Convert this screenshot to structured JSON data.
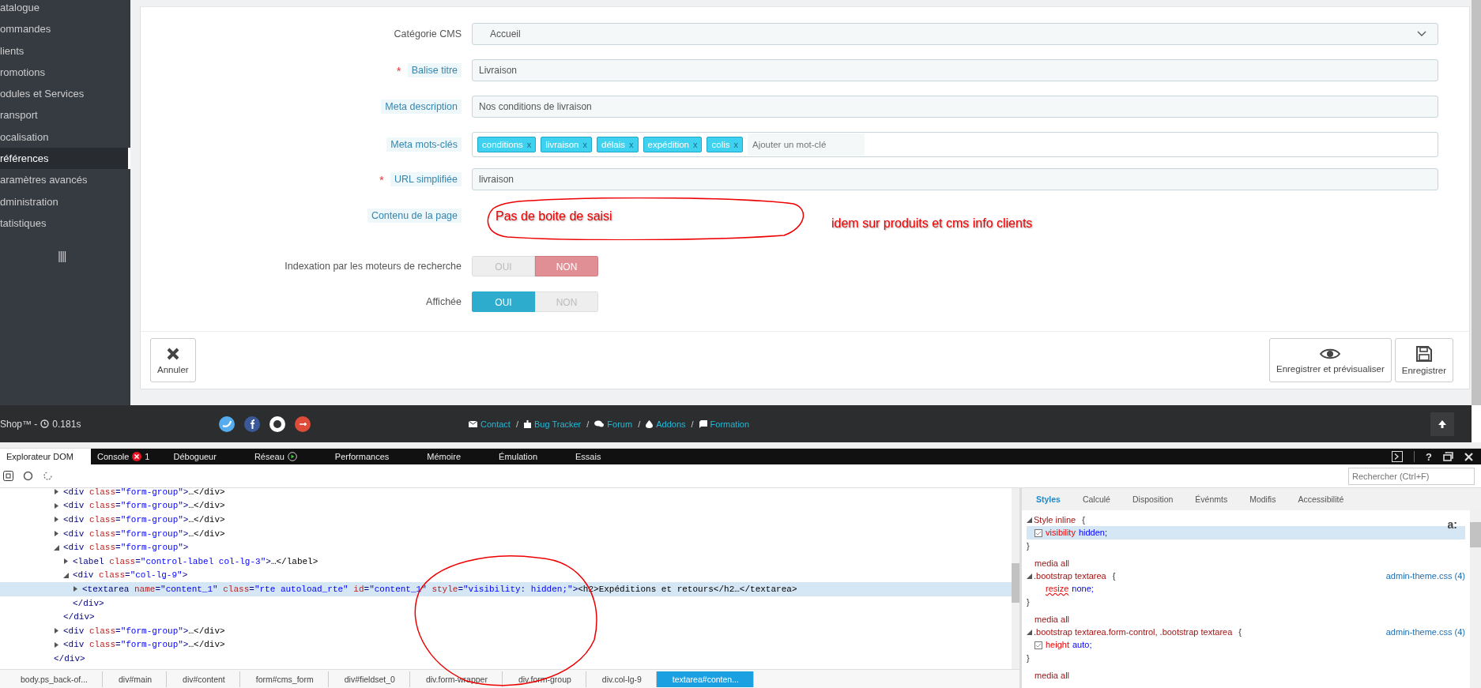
{
  "sidebar": {
    "items": [
      {
        "label": "atalogue",
        "selected": false
      },
      {
        "label": "ommandes",
        "selected": false
      },
      {
        "label": "lients",
        "selected": false
      },
      {
        "label": "romotions",
        "selected": false
      },
      {
        "label": "odules et Services",
        "selected": false
      },
      {
        "label": "ransport",
        "selected": false
      },
      {
        "label": "ocalisation",
        "selected": false
      },
      {
        "label": "références",
        "selected": true
      },
      {
        "label": "aramètres avancés",
        "selected": false
      },
      {
        "label": "dministration",
        "selected": false
      },
      {
        "label": "tatistiques",
        "selected": false
      }
    ]
  },
  "form": {
    "fields": [
      {
        "kind": "select",
        "label": "Catégorie CMS",
        "required": false,
        "hint": false,
        "value": "Accueil"
      },
      {
        "kind": "text",
        "label": "Balise titre",
        "required": true,
        "hint": true,
        "value": "Livraison"
      },
      {
        "kind": "text",
        "label": "Meta description",
        "required": false,
        "hint": true,
        "value": "Nos conditions de livraison"
      },
      {
        "kind": "tags",
        "label": "Meta mots-clés",
        "required": false,
        "hint": true,
        "tags": [
          {
            "label": "conditions",
            "remove": "x"
          },
          {
            "label": "livraison",
            "remove": "x"
          },
          {
            "label": "délais",
            "remove": "x"
          },
          {
            "label": "expédition",
            "remove": "x"
          },
          {
            "label": "colis",
            "remove": "x"
          }
        ],
        "placeholder": "Ajouter un mot-clé"
      },
      {
        "kind": "text",
        "label": "URL simplifiée",
        "required": true,
        "hint": true,
        "value": "livraison"
      },
      {
        "kind": "content",
        "label": "Contenu de la page",
        "required": false,
        "hint": true
      },
      {
        "kind": "toggle",
        "label": "Indexation par les moteurs de recherche",
        "required": false,
        "hint": false,
        "options": [
          {
            "label": "OUI",
            "kind": "yes",
            "selected": false
          },
          {
            "label": "NON",
            "kind": "no",
            "selected": true
          }
        ]
      },
      {
        "kind": "toggle",
        "label": "Affichée",
        "required": false,
        "hint": false,
        "options": [
          {
            "label": "OUI",
            "kind": "yes",
            "selected": true
          },
          {
            "label": "NON",
            "kind": "no",
            "selected": false
          }
        ]
      }
    ],
    "required_mark": "*",
    "actions": [
      {
        "label": "Annuler",
        "kind": "cancel"
      },
      {
        "label": "Enregistrer et prévisualiser",
        "kind": "preview"
      },
      {
        "label": "Enregistrer",
        "kind": "save"
      }
    ]
  },
  "footer": {
    "brand": "Shop™ -",
    "time": "0.181s",
    "links": [
      {
        "label": "Contact",
        "separator": "/"
      },
      {
        "label": "Bug Tracker",
        "separator": "/"
      },
      {
        "label": "Forum",
        "separator": "/"
      },
      {
        "label": "Addons",
        "separator": "/"
      },
      {
        "label": "Formation"
      }
    ]
  },
  "annotations": [
    "Pas de boite de saisi",
    "idem sur produits et cms info clients"
  ],
  "devtools": {
    "tabs": [
      {
        "label": "Explorateur DOM",
        "selected": true
      },
      {
        "label": "Console",
        "selected": false,
        "badge": "1"
      },
      {
        "label": "Débogueur",
        "selected": false
      },
      {
        "label": "Réseau",
        "selected": false,
        "recording": true
      },
      {
        "label": "Performances",
        "selected": false
      },
      {
        "label": "Mémoire",
        "selected": false
      },
      {
        "label": "Émulation",
        "selected": false
      },
      {
        "label": "Essais",
        "selected": false
      }
    ],
    "help": "?",
    "search": {
      "placeholder": "Rechercher (Ctrl+F)"
    },
    "dom": [
      {
        "open": "<div class=\"form-group\">",
        "collapsed": "…</div>",
        "expanded": false,
        "selected": false
      },
      {
        "open": "<div class=\"form-group\">",
        "collapsed": "…</div>",
        "expanded": false,
        "selected": false
      },
      {
        "open": "<div class=\"form-group\">",
        "collapsed": "…</div>",
        "expanded": false,
        "selected": false
      },
      {
        "open": "<div class=\"form-group\">",
        "collapsed": "…</div>",
        "expanded": false,
        "selected": false
      },
      {
        "open": "<div class=\"form-group\">",
        "close": "</div>",
        "expanded": true,
        "selected": false,
        "children": [
          {
            "open": "<label class=\"control-label col-lg-3\">",
            "collapsed": "…</label>",
            "expanded": false,
            "selected": false
          },
          {
            "open": "<div class=\"col-lg-9\">",
            "close": "</div>",
            "expanded": true,
            "selected": false,
            "children": [
              {
                "open": "<textarea name=\"content_1\" class=\"rte autoload_rte\" id=\"content_1\" style=\"visibility: hidden;\">",
                "collapsed": "<h2>Expéditions et retours</h2…</textarea>",
                "expanded": false,
                "selected": true
              }
            ]
          }
        ]
      },
      {
        "open": "<div class=\"form-group\">",
        "collapsed": "…</div>",
        "expanded": false,
        "selected": false
      },
      {
        "open": "<div class=\"form-group\">",
        "collapsed": "…</div>",
        "expanded": false,
        "selected": false
      }
    ],
    "dom_trailing": "</div>",
    "breadcrumb": [
      {
        "label": "body.ps_back-of...",
        "selected": false
      },
      {
        "label": "div#main",
        "selected": false
      },
      {
        "label": "div#content",
        "selected": false
      },
      {
        "label": "form#cms_form",
        "selected": false
      },
      {
        "label": "div#fieldset_0",
        "selected": false
      },
      {
        "label": "div.form-wrapper",
        "selected": false
      },
      {
        "label": "div.form-group",
        "selected": false
      },
      {
        "label": "div.col-lg-9",
        "selected": false
      },
      {
        "label": "textarea#conten...",
        "selected": true
      }
    ],
    "style_tabs": [
      {
        "label": "Styles",
        "selected": true
      },
      {
        "label": "Calculé",
        "selected": false
      },
      {
        "label": "Disposition",
        "selected": false
      },
      {
        "label": "Événmts",
        "selected": false
      },
      {
        "label": "Modifis",
        "selected": false
      },
      {
        "label": "Accessibilité",
        "selected": false
      }
    ],
    "pseudo": "a:",
    "rules": [
      {
        "selector": "Style inline",
        "open": "{",
        "close": "}",
        "declarations": [
          {
            "property": "visibility",
            "value": "hidden;",
            "kind": "checkbox",
            "selected": true
          }
        ]
      },
      {
        "media": "media all",
        "selector": ".bootstrap textarea",
        "open": "{",
        "close": "}",
        "source": "admin-theme.css (4)",
        "declarations": [
          {
            "property": "resize",
            "value": "none;",
            "kind": "invalid",
            "selected": false
          }
        ]
      },
      {
        "media": "media all",
        "selector": ".bootstrap textarea.form-control, .bootstrap textarea",
        "open": "{",
        "close": "}",
        "source": "admin-theme.css (4)",
        "declarations": [
          {
            "property": "height",
            "value": "auto;",
            "kind": "checkbox",
            "selected": false
          }
        ]
      },
      {
        "media": "media all"
      }
    ]
  }
}
